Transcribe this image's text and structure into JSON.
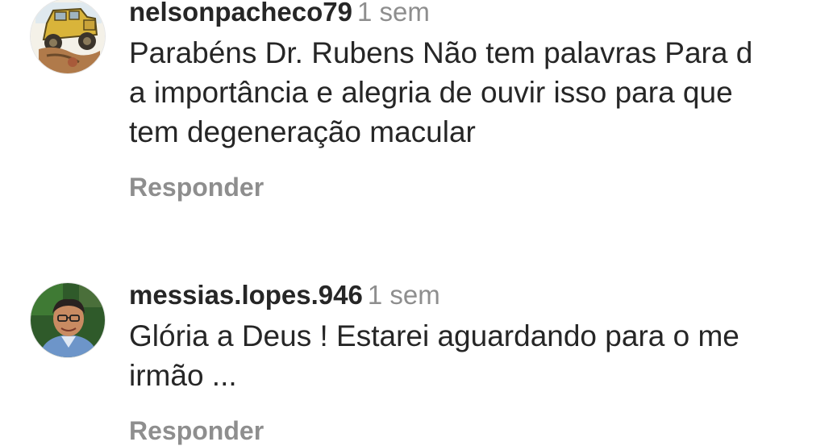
{
  "comments": [
    {
      "username": "nelsonpacheco79",
      "time": "1 sem",
      "text": "Parabéns Dr. Rubens Não tem palavras Para d\na importância e alegria de ouvir isso para que\ntem degeneração macular",
      "reply_label": "Responder",
      "avatar_icon": "jeep-avatar-icon"
    },
    {
      "username": "messias.lopes.946",
      "time": "1 sem",
      "text": "Glória a Deus ! Estarei aguardando para o me\nirmão ...",
      "reply_label": "Responder",
      "avatar_icon": "person-avatar-icon"
    }
  ],
  "colors": {
    "text": "#262626",
    "secondary": "#8e8e8e",
    "background": "#ffffff"
  }
}
